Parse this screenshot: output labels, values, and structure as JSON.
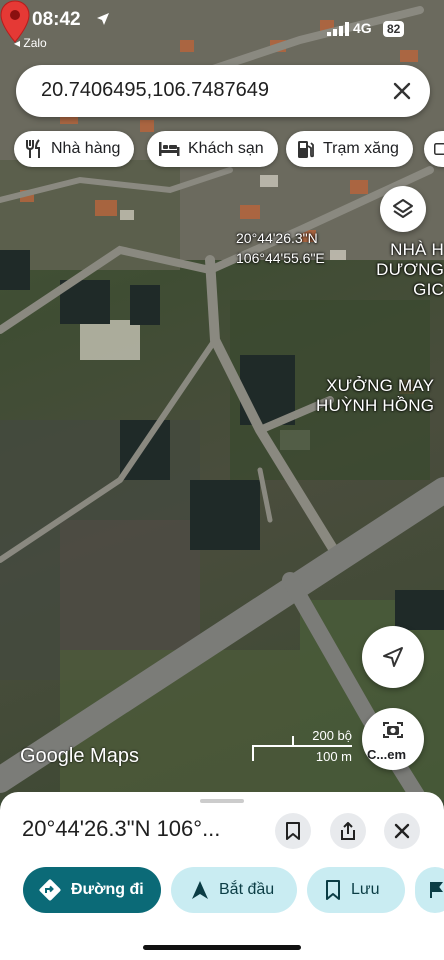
{
  "status_bar": {
    "time": "08:42",
    "back_app": "◂ Zalo",
    "network": "4G",
    "battery": "82"
  },
  "search": {
    "query": "20.7406495,106.7487649"
  },
  "chips": [
    {
      "label": "Nhà hàng",
      "icon": "fork-knife-icon"
    },
    {
      "label": "Khách sạn",
      "icon": "bed-icon"
    },
    {
      "label": "Trạm xăng",
      "icon": "gas-pump-icon"
    }
  ],
  "map": {
    "pin_label_lat": "20°44'26.3\"N",
    "pin_label_lng": "106°44'55.6\"E",
    "poi_1_line1": "NHÀ H",
    "poi_1_line2": "DƯƠNG GIC",
    "poi_2_line1": "XƯỞNG MAY",
    "poi_2_line2": "HUỲNH HỒNG",
    "attribution": "Google Maps",
    "scale_imperial": "200 bộ",
    "scale_metric": "100 m",
    "camera_button_label": "C...em"
  },
  "sheet": {
    "title": "20°44'26.3\"N 106°...",
    "actions": {
      "directions": "Đường đi",
      "start": "Bắt đầu",
      "save": "Lưu"
    }
  },
  "colors": {
    "primary_action": "#0b6a77",
    "secondary_action": "#c9ecf2",
    "pin": "#e53935"
  }
}
